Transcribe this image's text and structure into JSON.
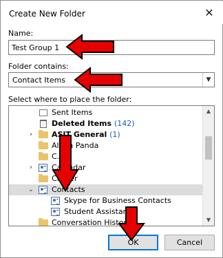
{
  "dialog": {
    "title": "Create New Folder",
    "close_glyph": "✕"
  },
  "name_label": "Name:",
  "name_value": "Test Group 1",
  "contains_label": "Folder contains:",
  "contains_value": "Contact Items",
  "place_label": "Select where to place the folder:",
  "tree": {
    "items": [
      {
        "label": "Sent Items",
        "icon": "sent-items-icon"
      },
      {
        "label": "Deleted Items",
        "count": "(142)",
        "icon": "trash-icon",
        "bold": true
      },
      {
        "label": "ASIT General",
        "count": "(1)",
        "icon": "folder-icon",
        "bold": true
      },
      {
        "label": "Alpha Panda",
        "icon": "folder-icon"
      },
      {
        "label": "C...",
        "icon": "folder-icon"
      },
      {
        "label": "Calendar",
        "icon": "calendar-icon"
      },
      {
        "label": "Clutter",
        "icon": "folder-icon"
      },
      {
        "label": "Contacts",
        "icon": "contacts-icon",
        "selected": true
      },
      {
        "label": "Skype for Business Contacts",
        "icon": "contacts-icon"
      },
      {
        "label": "Student Assistants",
        "icon": "contacts-icon"
      },
      {
        "label": "Conversation History",
        "icon": "folder-icon"
      }
    ]
  },
  "buttons": {
    "ok": "OK",
    "cancel": "Cancel"
  },
  "annotation_color": "#e60000"
}
